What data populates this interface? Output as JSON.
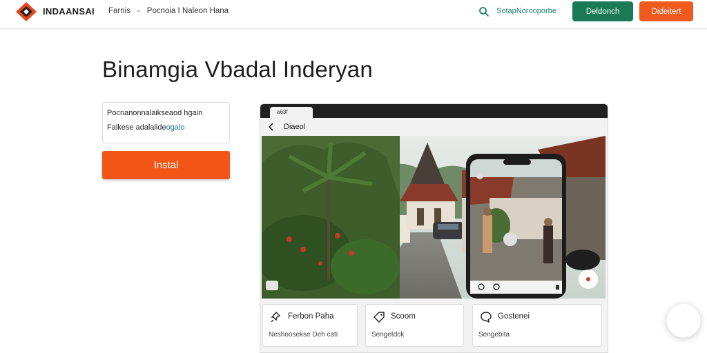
{
  "header": {
    "brand": "INDAANSAI",
    "nav": [
      "Farnis",
      "-",
      "Pocnoia I Naleon Hana"
    ],
    "search_label": "SotapNorooporbe",
    "primary_button": "Deldonch",
    "secondary_button": "Dideitert"
  },
  "page": {
    "title": "Binamgia Vbadal Inderyan"
  },
  "left_panel": {
    "description_line1": "Pocnanonnalaikseaod hgain",
    "description_line2_text": "Falkese adalalide",
    "description_line2_link": "ogalo",
    "install_button": "Instal"
  },
  "mockup": {
    "tab_label": "a63f",
    "nav_label": "Diaeol",
    "cards": [
      {
        "title": "Ferbon Paha",
        "subtitle": "Neshoosekse Deh cati",
        "icon": "pin-icon"
      },
      {
        "title": "Scoom",
        "subtitle": "Sengetdck",
        "icon": "tag-icon"
      },
      {
        "title": "Gostenei",
        "subtitle": "Sengebita",
        "icon": "chat-icon"
      }
    ]
  },
  "colors": {
    "accent_green": "#1a7a55",
    "accent_orange": "#f25516",
    "link": "#1a6f9a"
  }
}
